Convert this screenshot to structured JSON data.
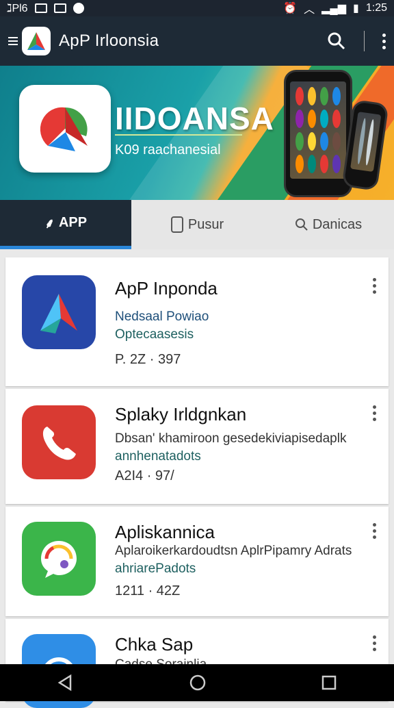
{
  "status_bar": {
    "left_text": "ℷPl6",
    "time": "1:25"
  },
  "app_bar": {
    "title": "ApP Irloonsia"
  },
  "banner": {
    "title": "IIDOANSA",
    "subtitle": "K09 raachanesial"
  },
  "tabs": [
    {
      "label": "APP",
      "icon": "leaf-icon",
      "active": true
    },
    {
      "label": "Pusur",
      "icon": "phone-icon",
      "active": false
    },
    {
      "label": "Danicas",
      "icon": "search-icon",
      "active": false
    }
  ],
  "apps": [
    {
      "title": "ApP Inponda",
      "line1": "Nedsaal Powiao",
      "line2": "Optecaasesis",
      "count": "P. 2Z · 397",
      "icon": "arrow-logo-icon",
      "color": "#2747a8"
    },
    {
      "title": "Splaky Irldgnkan",
      "line1": "Dbsan' khamiroon gesedekiviapisedaplk",
      "line2": "annhenatadots",
      "count": "A2I4 · 97/",
      "icon": "phone-handset-icon",
      "color": "#d93a32"
    },
    {
      "title": "Apliskannica",
      "line1": "Aplaroikerkardoudtsn AplrPipamry Adrats",
      "line2": "ahriarePadots",
      "count": "1211 · 42Z",
      "icon": "chat-gear-icon",
      "color": "#3bb54a"
    },
    {
      "title": "Chka Sap",
      "line1": "Cadse Sorainlia",
      "line2": "",
      "count": "",
      "icon": "circle-arrow-icon",
      "color": "#2f8ee6"
    }
  ]
}
